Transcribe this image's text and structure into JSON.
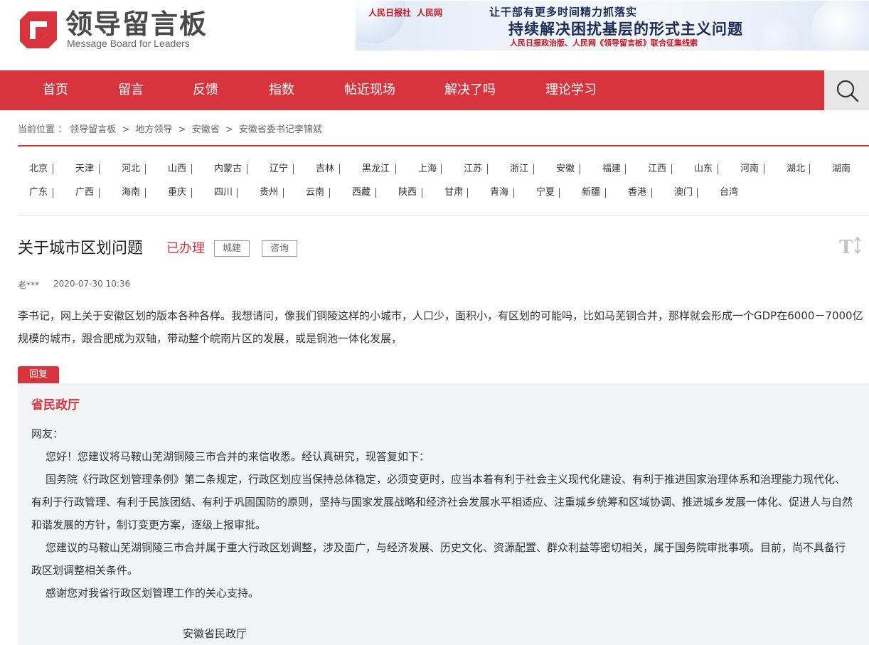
{
  "site": {
    "logo_cn": "领导留言板",
    "logo_en": "Message Board for Leaders"
  },
  "banner": {
    "logo1": "人民日报社",
    "logo2": "人民网",
    "line1": "让干部有更多时间精力抓落实",
    "line2": "持续解决困扰基层的形式主义问题",
    "line3": "人民日报政治版、人民网《领导留言板》联合征集线索"
  },
  "nav": {
    "items": [
      "首页",
      "留言",
      "反馈",
      "指数",
      "帖近现场",
      "解决了吗",
      "理论学习"
    ],
    "search_icon": "search-icon"
  },
  "breadcrumb": {
    "label": "当前位置 ：",
    "items": [
      "领导留言板",
      "地方领导",
      "安徽省",
      "安徽省委书记李锦斌"
    ],
    "separator": ">"
  },
  "provinces": {
    "row1": [
      "北京",
      "天津",
      "河北",
      "山西",
      "内蒙古",
      "辽宁",
      "吉林",
      "黑龙江",
      "上海",
      "江苏",
      "浙江",
      "安徽",
      "福建",
      "江西",
      "山东",
      "河南",
      "湖北",
      "湖南"
    ],
    "row2": [
      "广东",
      "广西",
      "海南",
      "重庆",
      "四川",
      "贵州",
      "云南",
      "西藏",
      "陕西",
      "甘肃",
      "青海",
      "宁夏",
      "新疆",
      "香港",
      "澳门",
      "台湾"
    ]
  },
  "post": {
    "title": "关于城市区划问题",
    "status": "已办理",
    "tags": [
      "城建",
      "咨询"
    ],
    "user": "老***",
    "time": "2020-07-30 10:36",
    "content": "李书记，网上关于安徽区划的版本各种各样。我想请问，像我们铜陵这样的小城市，人口少，面积小，有区划的可能吗，比如马芜铜合并，那样就会形成一个GDP在6000－7000亿规模的城市，跟合肥成为双轴，带动整个皖南片区的发展，或是铜池一体化发展，"
  },
  "reply": {
    "badge": "回复",
    "org": "省民政厅",
    "greeting": "网友：",
    "paragraphs": [
      "您好！您建议将马鞍山芜湖铜陵三市合并的来信收悉。经认真研究，现答复如下：",
      "国务院《行政区划管理条例》第二条规定，行政区划应当保持总体稳定，必须变更时，应当本着有利于社会主义现代化建设、有利于推进国家治理体系和治理能力现代化、有利于行政管理、有利于民族团结、有利于巩固国防的原则，坚持与国家发展战略和经济社会发展水平相适应、注重城乡统筹和区域协调、推进城乡发展一体化、促进人与自然和谐发展的方针，制订变更方案，逐级上报审批。",
      "您建议的马鞍山芜湖铜陵三市合并属于重大行政区划调整，涉及面广，与经济发展、历史文化、资源配置、群众利益等密切相关，属于国务院审批事项。目前，尚不具备行政区划调整相关条件。",
      "感谢您对我省行政区划管理工作的关心支持。"
    ],
    "signature": "安徽省民政厅"
  },
  "colors": {
    "brand_red": "#d7343e",
    "reply_bg": "#f2f3f5"
  }
}
